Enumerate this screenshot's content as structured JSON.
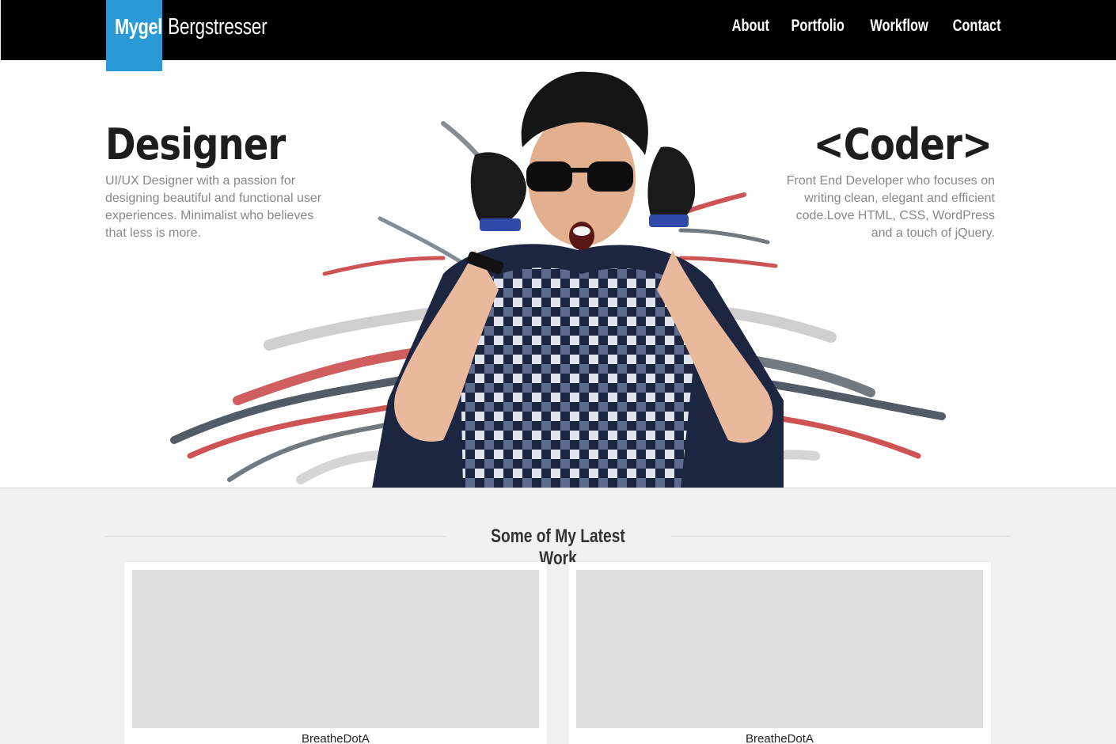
{
  "header": {
    "logo_first": "Mygel",
    "logo_last": "Bergstresser",
    "nav": [
      "About",
      "Portfolio",
      "Workflow",
      "Contact"
    ]
  },
  "hero": {
    "left_title": "Designer",
    "left_text": "UI/UX Designer with a passion for designing beautiful and functional user experiences. Minimalist who believes that less is more.",
    "right_title": "<Coder>",
    "right_text": "Front End Developer who focuses on writing clean, elegant and efficient code.Love HTML, CSS, WordPress and a touch of jQuery."
  },
  "work": {
    "heading": "Some of My Latest Work",
    "items": [
      {
        "title": "BreatheDotA"
      },
      {
        "title": "BreatheDotA"
      }
    ]
  },
  "colors": {
    "accent": "#2a9ad6",
    "header_bg": "#000000",
    "body_bg": "#f1f1f1"
  }
}
